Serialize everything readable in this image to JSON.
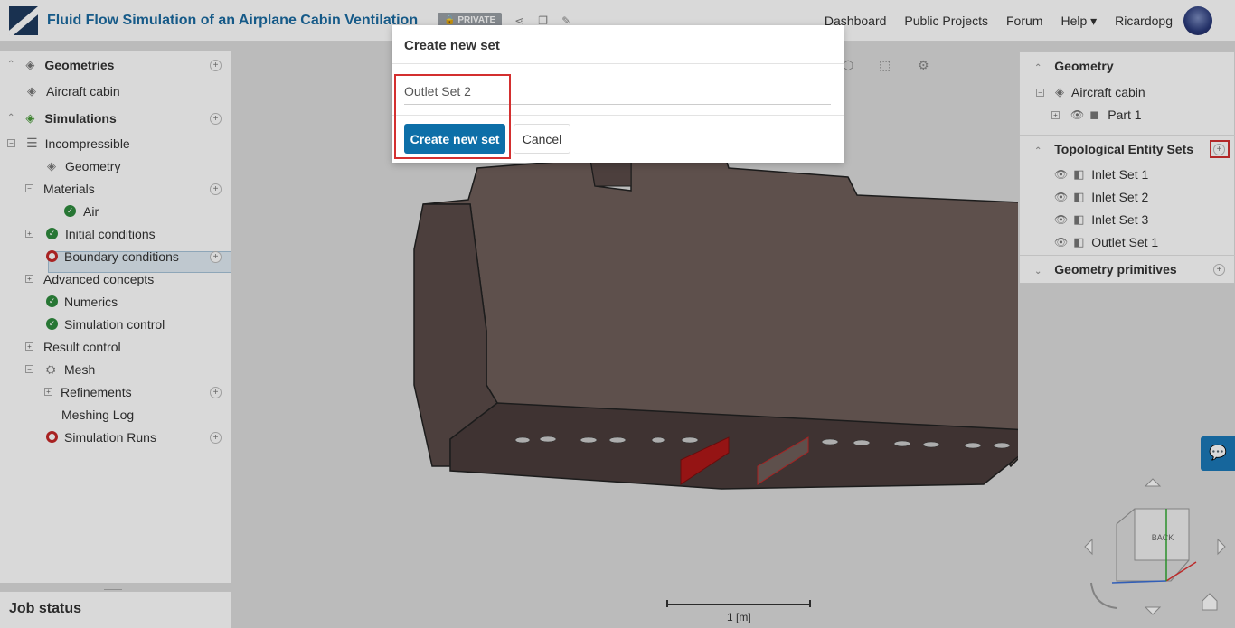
{
  "header": {
    "title": "Fluid Flow Simulation of an Airplane Cabin Ventilation",
    "private_label": "PRIVATE",
    "nav": {
      "dashboard": "Dashboard",
      "public_projects": "Public Projects",
      "forum": "Forum",
      "help": "Help",
      "username": "Ricardopg"
    }
  },
  "left_tree": {
    "geometries_label": "Geometries",
    "aircraft_cabin": "Aircraft cabin",
    "simulations_label": "Simulations",
    "incompressible": "Incompressible",
    "geometry": "Geometry",
    "materials": "Materials",
    "air": "Air",
    "initial_conditions": "Initial conditions",
    "boundary_conditions": "Boundary conditions",
    "advanced_concepts": "Advanced concepts",
    "numerics": "Numerics",
    "simulation_control": "Simulation control",
    "result_control": "Result control",
    "mesh": "Mesh",
    "refinements": "Refinements",
    "meshing_log": "Meshing Log",
    "simulation_runs": "Simulation Runs"
  },
  "job_status": "Job status",
  "right_panel": {
    "geometry_label": "Geometry",
    "aircraft_cabin": "Aircraft cabin",
    "part1": "Part 1",
    "topo_sets_label": "Topological Entity Sets",
    "sets": [
      "Inlet Set 1",
      "Inlet Set 2",
      "Inlet Set 3",
      "Outlet Set 1"
    ],
    "geometry_primitives": "Geometry primitives"
  },
  "modal": {
    "title": "Create new set",
    "input_value": "Outlet Set 2",
    "create_label": "Create new set",
    "cancel_label": "Cancel"
  },
  "viewport": {
    "scale_label": "1 [m]",
    "view_cube_label": "BACK"
  },
  "colors": {
    "accent": "#0d6fa8",
    "title": "#1a6aa0",
    "highlight": "#d32f2f",
    "ok": "#2e8b3e",
    "error": "#c62828"
  }
}
